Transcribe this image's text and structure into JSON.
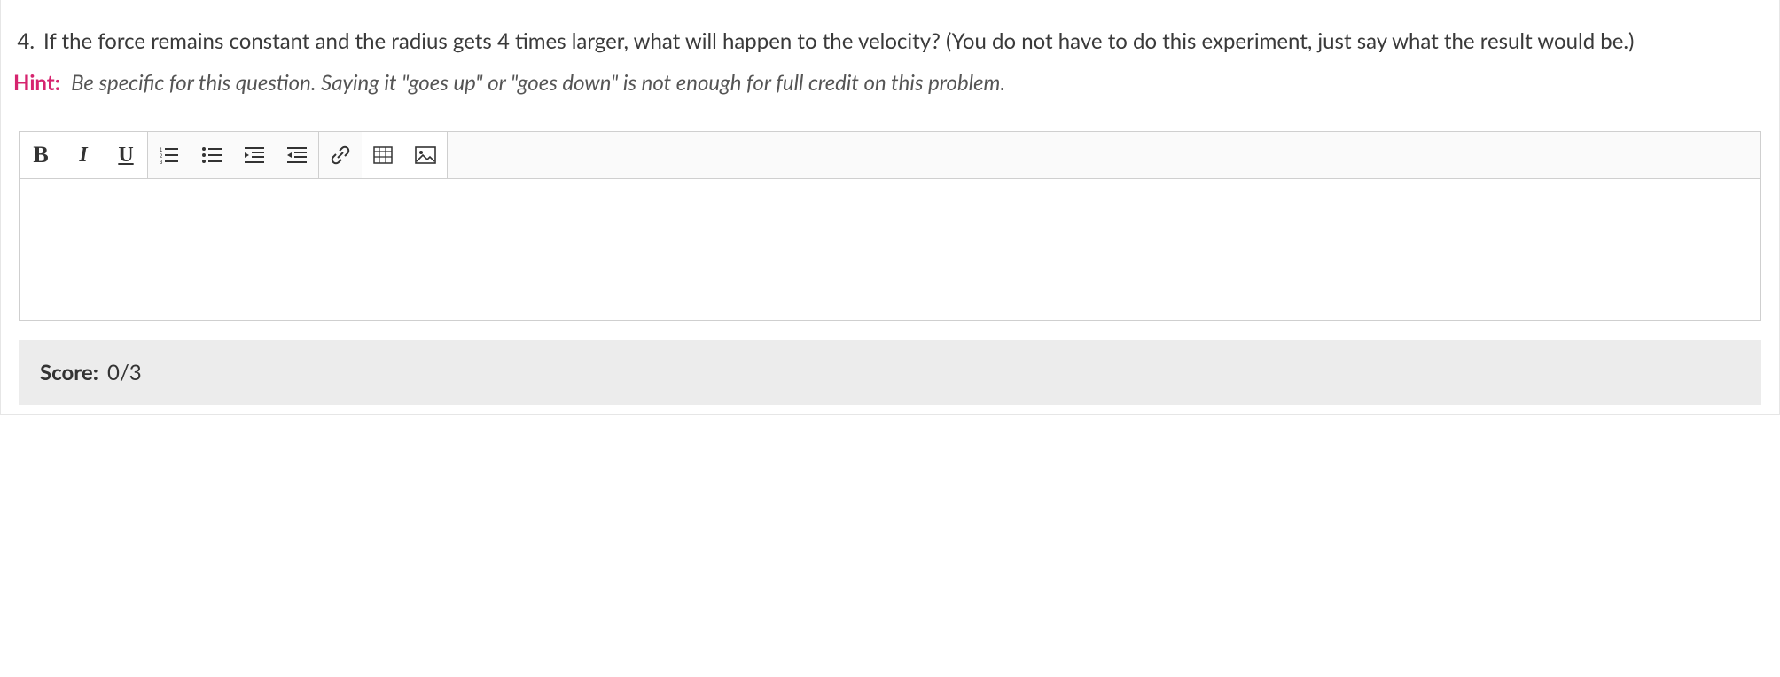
{
  "question": {
    "number": "4.",
    "text": "If the force remains constant and the radius gets 4 times larger, what will happen to the velocity? (You do not have to do this experiment, just say what the result would be.)"
  },
  "hint": {
    "label": "Hint:",
    "text": "Be specific for this question. Saying it \"goes up\" or \"goes down\" is not enough for full credit on this problem."
  },
  "toolbar": {
    "bold": "B",
    "italic": "I",
    "underline": "U"
  },
  "editor": {
    "content": ""
  },
  "score": {
    "label": "Score:",
    "value": "0/3"
  }
}
